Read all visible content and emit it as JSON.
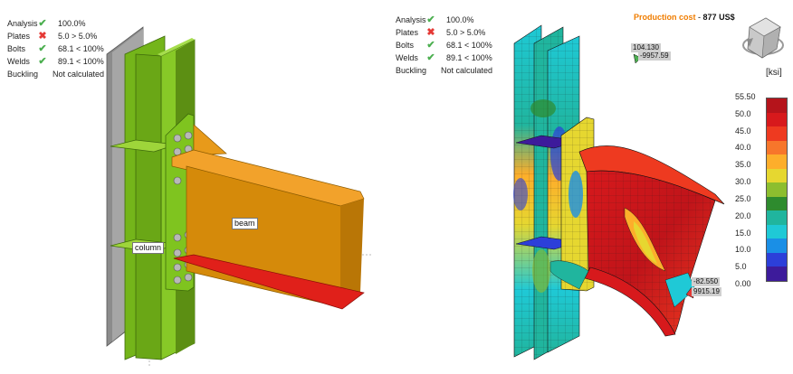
{
  "checks": [
    {
      "label": "Analysis",
      "status": "ok",
      "value": "100.0%"
    },
    {
      "label": "Plates",
      "status": "fail",
      "value": "5.0 > 5.0%"
    },
    {
      "label": "Bolts",
      "status": "ok",
      "value": "68.1 < 100%"
    },
    {
      "label": "Welds",
      "status": "ok",
      "value": "89.1 < 100%"
    },
    {
      "label": "Buckling",
      "status": "none",
      "value": "Not calculated"
    }
  ],
  "icons": {
    "ok": "checkmark-icon",
    "fail": "cross-icon"
  },
  "labels": {
    "column": "column",
    "beam": "beam"
  },
  "production": {
    "label": "Production cost",
    "separator": "-",
    "value": "877 US$"
  },
  "legend": {
    "unit": "[ksi]",
    "ticks": [
      "55.50",
      "50.0",
      "45.0",
      "40.0",
      "35.0",
      "30.0",
      "25.0",
      "20.0",
      "15.0",
      "10.0",
      "5.0",
      "0.00"
    ],
    "colors": [
      "#b5141b",
      "#d7191c",
      "#ee3a20",
      "#f7762b",
      "#fdae2b",
      "#e6d730",
      "#8dbe2f",
      "#2e8b2e",
      "#20b59e",
      "#1fc9d6",
      "#1a8fe6",
      "#2c3fd9",
      "#3d1b9b"
    ]
  },
  "result_tags": {
    "top_value1": "104.130",
    "top_value2": "-9957.59",
    "bottom_value1": "-82.550",
    "bottom_value2": "9915.19"
  },
  "colors": {
    "column": "#7fc41f",
    "beam": "#d58a0a",
    "flange_red": "#e0201a"
  }
}
